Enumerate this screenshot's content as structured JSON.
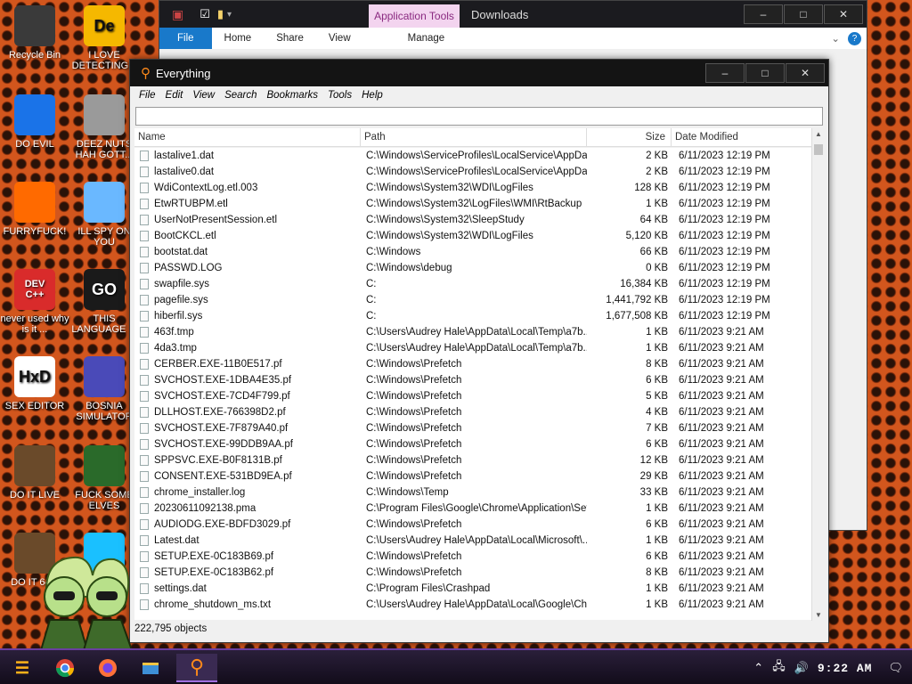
{
  "desktop_icons": [
    {
      "label": "Recycle Bin",
      "icon": "recycle-bin-icon",
      "color": "#3a3a3a"
    },
    {
      "label": "I LOVE DETECTING...",
      "icon": "detect-it-easy-icon",
      "color": "#f5b800",
      "glyph": "De"
    },
    {
      "label": "DO EVIL",
      "icon": "chrome-icon",
      "color": "#1a73e8"
    },
    {
      "label": "DEEZ NUTS HAH GOTT...",
      "icon": "stacked-windows-icon",
      "color": "#9a9a9a"
    },
    {
      "label": "FURRYFUCK!",
      "icon": "firefox-icon",
      "color": "#ff6a00"
    },
    {
      "label": "ILL SPY ON YOU",
      "icon": "spy-network-icon",
      "color": "#6ab8ff"
    },
    {
      "label": "never used why is it ...",
      "icon": "devcpp-icon",
      "color": "#d92b2b",
      "glyph": "DEV C++"
    },
    {
      "label": "THIS LANGUAGE ...",
      "icon": "golang-icon",
      "color": "#1a1a1a",
      "glyph": "GO"
    },
    {
      "label": "SEX EDITOR",
      "icon": "hxd-editor-icon",
      "color": "#ffffff",
      "glyph": "HxD"
    },
    {
      "label": "BOSNIA SIMULATOR",
      "icon": "mine-icon",
      "color": "#4a4ab8"
    },
    {
      "label": "DO IT LIVE",
      "icon": "portrait-icon",
      "color": "#6a4a2a"
    },
    {
      "label": "FUCK SOME ELVES",
      "icon": "elf-game-icon",
      "color": "#2a6a2a"
    },
    {
      "label": "DO IT 64...",
      "icon": "portrait-icon",
      "color": "#6a4a2a"
    },
    {
      "label": "",
      "icon": "diamond-icon",
      "color": "#1ac0ff"
    }
  ],
  "explorer": {
    "context_tab": "Application Tools",
    "title": "Downloads",
    "ribbon_tabs": [
      "File",
      "Home",
      "Share",
      "View",
      "Manage"
    ]
  },
  "everything": {
    "title": "Everything",
    "menu": [
      "File",
      "Edit",
      "View",
      "Search",
      "Bookmarks",
      "Tools",
      "Help"
    ],
    "search_value": "",
    "columns": {
      "name": "Name",
      "path": "Path",
      "size": "Size",
      "date": "Date Modified"
    },
    "rows": [
      [
        "lastalive1.dat",
        "C:\\Windows\\ServiceProfiles\\LocalService\\AppDat...",
        "2 KB",
        "6/11/2023 12:19 PM"
      ],
      [
        "lastalive0.dat",
        "C:\\Windows\\ServiceProfiles\\LocalService\\AppDat...",
        "2 KB",
        "6/11/2023 12:19 PM"
      ],
      [
        "WdiContextLog.etl.003",
        "C:\\Windows\\System32\\WDI\\LogFiles",
        "128 KB",
        "6/11/2023 12:19 PM"
      ],
      [
        "EtwRTUBPM.etl",
        "C:\\Windows\\System32\\LogFiles\\WMI\\RtBackup",
        "1 KB",
        "6/11/2023 12:19 PM"
      ],
      [
        "UserNotPresentSession.etl",
        "C:\\Windows\\System32\\SleepStudy",
        "64 KB",
        "6/11/2023 12:19 PM"
      ],
      [
        "BootCKCL.etl",
        "C:\\Windows\\System32\\WDI\\LogFiles",
        "5,120 KB",
        "6/11/2023 12:19 PM"
      ],
      [
        "bootstat.dat",
        "C:\\Windows",
        "66 KB",
        "6/11/2023 12:19 PM"
      ],
      [
        "PASSWD.LOG",
        "C:\\Windows\\debug",
        "0 KB",
        "6/11/2023 12:19 PM"
      ],
      [
        "swapfile.sys",
        "C:",
        "16,384 KB",
        "6/11/2023 12:19 PM"
      ],
      [
        "pagefile.sys",
        "C:",
        "1,441,792 KB",
        "6/11/2023 12:19 PM"
      ],
      [
        "hiberfil.sys",
        "C:",
        "1,677,508 KB",
        "6/11/2023 12:19 PM"
      ],
      [
        "463f.tmp",
        "C:\\Users\\Audrey Hale\\AppData\\Local\\Temp\\a7b...",
        "1 KB",
        "6/11/2023 9:21 AM"
      ],
      [
        "4da3.tmp",
        "C:\\Users\\Audrey Hale\\AppData\\Local\\Temp\\a7b...",
        "1 KB",
        "6/11/2023 9:21 AM"
      ],
      [
        "CERBER.EXE-11B0E517.pf",
        "C:\\Windows\\Prefetch",
        "8 KB",
        "6/11/2023 9:21 AM"
      ],
      [
        "SVCHOST.EXE-1DBA4E35.pf",
        "C:\\Windows\\Prefetch",
        "6 KB",
        "6/11/2023 9:21 AM"
      ],
      [
        "SVCHOST.EXE-7CD4F799.pf",
        "C:\\Windows\\Prefetch",
        "5 KB",
        "6/11/2023 9:21 AM"
      ],
      [
        "DLLHOST.EXE-766398D2.pf",
        "C:\\Windows\\Prefetch",
        "4 KB",
        "6/11/2023 9:21 AM"
      ],
      [
        "SVCHOST.EXE-7F879A40.pf",
        "C:\\Windows\\Prefetch",
        "7 KB",
        "6/11/2023 9:21 AM"
      ],
      [
        "SVCHOST.EXE-99DDB9AA.pf",
        "C:\\Windows\\Prefetch",
        "6 KB",
        "6/11/2023 9:21 AM"
      ],
      [
        "SPPSVC.EXE-B0F8131B.pf",
        "C:\\Windows\\Prefetch",
        "12 KB",
        "6/11/2023 9:21 AM"
      ],
      [
        "CONSENT.EXE-531BD9EA.pf",
        "C:\\Windows\\Prefetch",
        "29 KB",
        "6/11/2023 9:21 AM"
      ],
      [
        "chrome_installer.log",
        "C:\\Windows\\Temp",
        "33 KB",
        "6/11/2023 9:21 AM"
      ],
      [
        "20230611092138.pma",
        "C:\\Program Files\\Google\\Chrome\\Application\\Set...",
        "1 KB",
        "6/11/2023 9:21 AM"
      ],
      [
        "AUDIODG.EXE-BDFD3029.pf",
        "C:\\Windows\\Prefetch",
        "6 KB",
        "6/11/2023 9:21 AM"
      ],
      [
        "Latest.dat",
        "C:\\Users\\Audrey Hale\\AppData\\Local\\Microsoft\\...",
        "1 KB",
        "6/11/2023 9:21 AM"
      ],
      [
        "SETUP.EXE-0C183B69.pf",
        "C:\\Windows\\Prefetch",
        "6 KB",
        "6/11/2023 9:21 AM"
      ],
      [
        "SETUP.EXE-0C183B62.pf",
        "C:\\Windows\\Prefetch",
        "8 KB",
        "6/11/2023 9:21 AM"
      ],
      [
        "settings.dat",
        "C:\\Program Files\\Crashpad",
        "1 KB",
        "6/11/2023 9:21 AM"
      ],
      [
        "chrome_shutdown_ms.txt",
        "C:\\Users\\Audrey Hale\\AppData\\Local\\Google\\Ch...",
        "1 KB",
        "6/11/2023 9:21 AM"
      ]
    ],
    "status": "222,795 objects"
  },
  "taskbar": {
    "clock": "9:22 AM",
    "pinned": [
      "start-icon",
      "chrome-icon",
      "firefox-icon",
      "file-explorer-icon",
      "everything-icon"
    ]
  },
  "colors": {
    "accent": "#1979ca",
    "taskbar_border": "#6a3fa0",
    "everything_logo": "#ff8a1a"
  }
}
